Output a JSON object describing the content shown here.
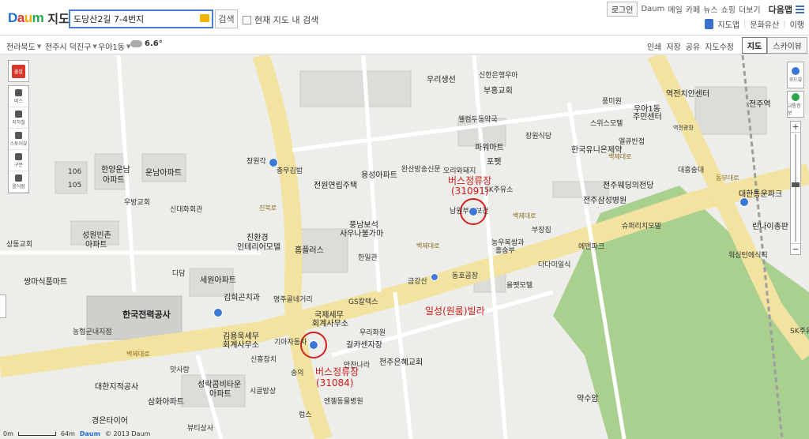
{
  "header": {
    "logo": {
      "brand_d": "D",
      "brand_a": "a",
      "brand_u": "u",
      "brand_m": "m",
      "service": "지도"
    },
    "search": {
      "value": "도당산2길 7-4번지",
      "button": "검색",
      "in_map_label": "현재 지도 내 검색"
    },
    "top_links": {
      "login": "로그인",
      "items": [
        "Daum",
        "메일",
        "카페",
        "뉴스",
        "쇼핑",
        "더보기"
      ],
      "all_services": "다음맵"
    },
    "service_links": {
      "app": "지도앱",
      "culture": "문화유산",
      "route": "이행"
    }
  },
  "toolbar": {
    "region1": "전라북도",
    "region2": "전주시 덕진구",
    "region3": "우아1동",
    "temperature": "6.6°",
    "tools": [
      "인쇄",
      "저장",
      "공유",
      "지도수정"
    ],
    "views": {
      "map": "지도",
      "skyview": "스카이뷰"
    }
  },
  "map": {
    "labels": {
      "l1": "106",
      "l2": "105",
      "l3": "한양운남",
      "l4": "아파트",
      "l5": "운남아파트",
      "l6": "우방교회",
      "l7": "신대화회관",
      "l8": "성원빈촌",
      "l9": "아파트",
      "l10": "상동교회",
      "l11": "쌍마식품마트",
      "l12": "세원아파트",
      "l13": "다담",
      "l14": "김희곤치과",
      "l15": "한국전력공사",
      "l16": "농협군내지점",
      "l17": "김용욱세무",
      "l18": "회계사무소",
      "l19": "신흥참치",
      "l20": "맛사랑",
      "l21": "대한지적공사",
      "l22": "성락콤비타운",
      "l23": "아파트",
      "l24": "시골밥상",
      "l25": "삼화아파트",
      "l26": "경은타이어",
      "l27": "뷰티상사",
      "l28": "창원각",
      "l29": "충무김밥",
      "l30": "전원연립주택",
      "l31": "용성아파트",
      "l32": "친환경",
      "l33": "인테리어모델",
      "l34": "홈플러스",
      "l35": "풍남보석",
      "l36": "사우나불가마",
      "l37": "한일관",
      "l38": "명주골네거리",
      "l39": "GS칼텍스",
      "l40": "국제세무",
      "l41": "회계사무소",
      "l42": "기아자동차",
      "l43": "우리화원",
      "l44": "길카센자장",
      "l45": "만찬나라",
      "l46": "전주은혜교회",
      "l47": "송의",
      "l48": "엔젤동물병원",
      "l49": "럼스",
      "l50": "우리생선",
      "l51": "신한은행우아",
      "l52": "부흥교회",
      "l53": "웰컴두동약국",
      "l54": "파워마트",
      "l55": "포펫",
      "l56": "완산방송신문",
      "l57": "오리와돼지",
      "l58": "SK주유소",
      "l59": "남원부강보건",
      "l60": "농우복쌈과",
      "l61": "홀숨부",
      "l62": "부장집",
      "l63": "다다미일식",
      "l64": "금강산",
      "l65": "동호곰장",
      "l66": "올펫모텔",
      "l67": "장원식당",
      "l68": "한국유니온제약",
      "l69": "스위스모텔",
      "l70": "우아1동",
      "l71": "주민센터",
      "l72": "풍미원",
      "l73": "엘큐반점",
      "l74": "역전치안센터",
      "l75": "전주역",
      "l76": "전주웨딩의전당",
      "l77": "전주삼성병원",
      "l78": "슈퍼리치모델",
      "l79": "에덴파크",
      "l80": "대흥숭대",
      "l81": "대한통운파크",
      "l82": "린나이총판",
      "l83": "워싱턴에식직",
      "l84": "SK주유",
      "l85": "역전광장",
      "l86": "약수암"
    },
    "roads": {
      "r1": "백제대로",
      "r2": "백제대로",
      "r3": "백제대로",
      "r4": "백제대로",
      "r5": "진북로",
      "r6": "동부대로"
    },
    "annotations": {
      "bus1_title": "버스정류장",
      "bus1_code": "(31091)",
      "bus2_title": "버스정류장",
      "bus2_code": "(31084)",
      "villa": "일성(원룸)빌라"
    },
    "left_tools": {
      "stamp": "출발",
      "t1": "버스",
      "t2": "지하철",
      "t3": "스토어뷰",
      "t4": "구분",
      "t5": "음식점"
    },
    "right_tools": {
      "roadview": "로드뷰",
      "traffic": "교통정보"
    },
    "zoom": {
      "plus": "+",
      "minus": "−"
    }
  },
  "footer": {
    "scale_zero": "0m",
    "scale_max": "64m",
    "copyright": "© 2013 Daum",
    "footer_brand": "Daum"
  }
}
